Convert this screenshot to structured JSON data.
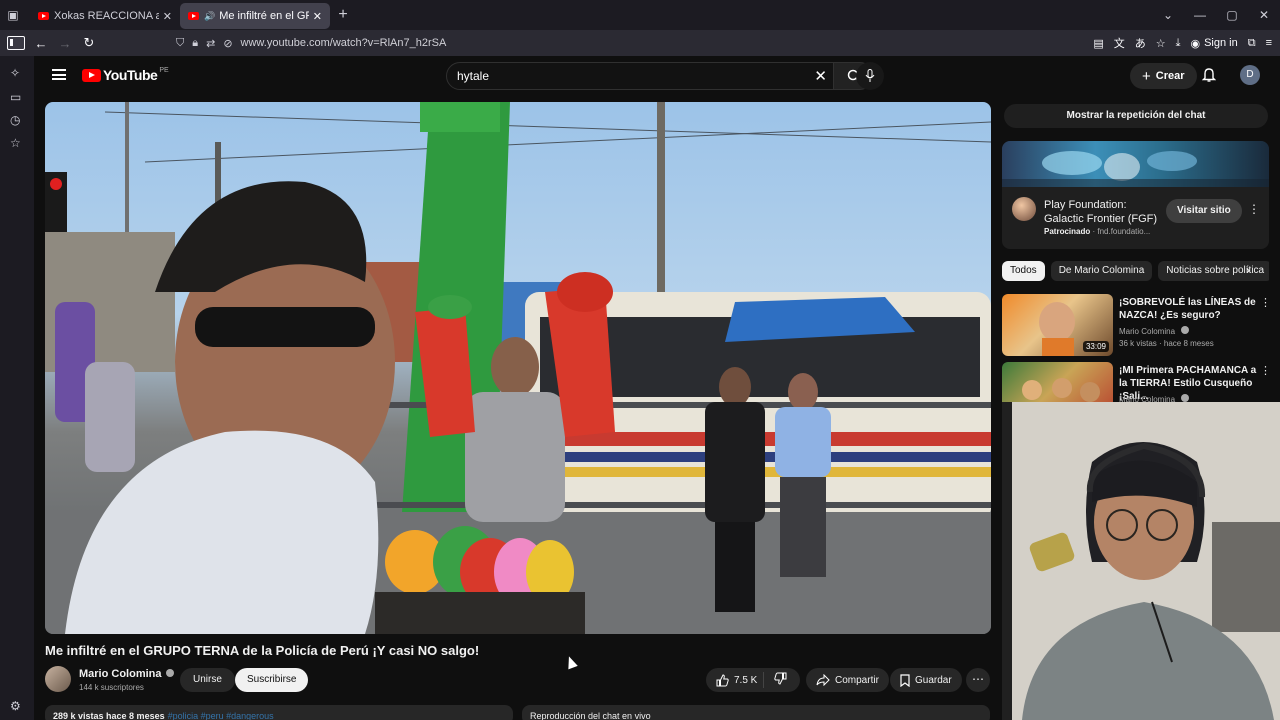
{
  "browser": {
    "tabs": [
      {
        "title": "Xokas REACCIONA a las NOVEDADES",
        "active": false
      },
      {
        "title": "Me infiltré en el GRUPO TERNA",
        "active": true
      }
    ],
    "url": "www.youtube.com/watch?v=RlAn7_h2rSA",
    "sign_in": "Sign in"
  },
  "youtube": {
    "logo": "YouTube",
    "country": "PE",
    "search_query": "hytale",
    "create_label": "Crear",
    "user_initial": "D"
  },
  "video": {
    "title": "Me infiltré en el GRUPO TERNA de la Policía de Perú ¡Y casi NO salgo!",
    "channel": "Mario Colomina",
    "subscribers": "144 k suscriptores",
    "join_label": "Unirse",
    "subscribe_label": "Suscribirse",
    "likes": "7.5 K",
    "share_label": "Compartir",
    "save_label": "Guardar",
    "description_stats": "289 k vistas  hace 8 meses",
    "description_tags": "#policia #peru #dangerous",
    "chat_replay_box": "Reproducción del chat en vivo"
  },
  "sidebar": {
    "chat_replay_button": "Mostrar la repetición del chat",
    "ad": {
      "title": "Play Foundation: Galactic Frontier (FGF)",
      "sponsored": "Patrocinado",
      "domain": "fnd.foundatio...",
      "visit_label": "Visitar sitio"
    },
    "chips": [
      "Todos",
      "De Mario Colomina",
      "Noticias sobre política"
    ],
    "recommendations": [
      {
        "title": "¡SOBREVOLÉ las LÍNEAS de NAZCA! ¿Es seguro?",
        "channel": "Mario Colomina",
        "meta": "36 k vistas · hace 8 meses",
        "duration": "33:09"
      },
      {
        "title": "¡MI Primera PACHAMANCA a la TIERRA! Estilo Cusqueño ¡Sali...",
        "channel": "Mario Colomina",
        "meta": "",
        "duration": ""
      }
    ]
  },
  "colors": {
    "background": "#0f0f0f",
    "brand_red": "#ff0000",
    "chip_active": "#f1f1f1",
    "link_blue": "#3ea6ff"
  },
  "icons": [
    "tab-list-icon",
    "speaker-icon",
    "close-icon",
    "plus-icon",
    "chevron-down-icon",
    "minimize-icon",
    "maximize-icon",
    "back-icon",
    "forward-icon",
    "reload-icon",
    "shield-icon",
    "lock-icon",
    "menu-icon",
    "search-icon",
    "mic-icon",
    "bell-icon",
    "like-icon",
    "dislike-icon",
    "share-icon",
    "bookmark-icon",
    "more-icon"
  ]
}
